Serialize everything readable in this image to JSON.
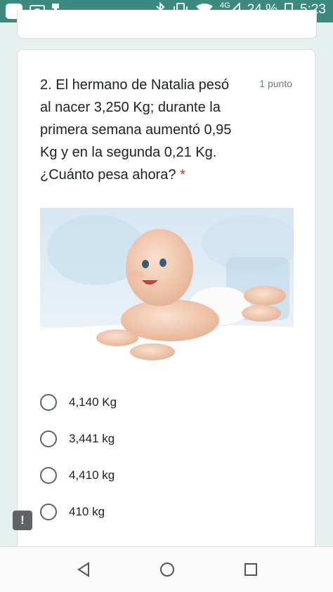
{
  "status_bar": {
    "network": "4G",
    "battery": "24 %",
    "time": "5:23",
    "icons": [
      "app-icon",
      "picture-icon",
      "flashlight-icon",
      "bluetooth-icon",
      "vibrate-icon",
      "wifi-icon",
      "signal-icon",
      "battery-icon"
    ]
  },
  "question": {
    "text": "2. El hermano de Natalia pesó al nacer 3,250 Kg; durante la primera semana aumentó 0,95 Kg y en la segunda 0,21 Kg. ¿Cuánto pesa ahora?",
    "required_mark": "*",
    "points": "1 punto",
    "image_alt": "baby-photo"
  },
  "options": [
    {
      "label": "4,140 Kg"
    },
    {
      "label": "3,441 kg"
    },
    {
      "label": "4,410 kg"
    },
    {
      "label": "410 kg"
    }
  ],
  "feedback_icon": "!",
  "navigation": [
    "back-icon",
    "home-icon",
    "recents-icon"
  ],
  "colors": {
    "status_bar": "#3c8a7e",
    "background": "#e6f0ee",
    "required": "#d93025"
  }
}
